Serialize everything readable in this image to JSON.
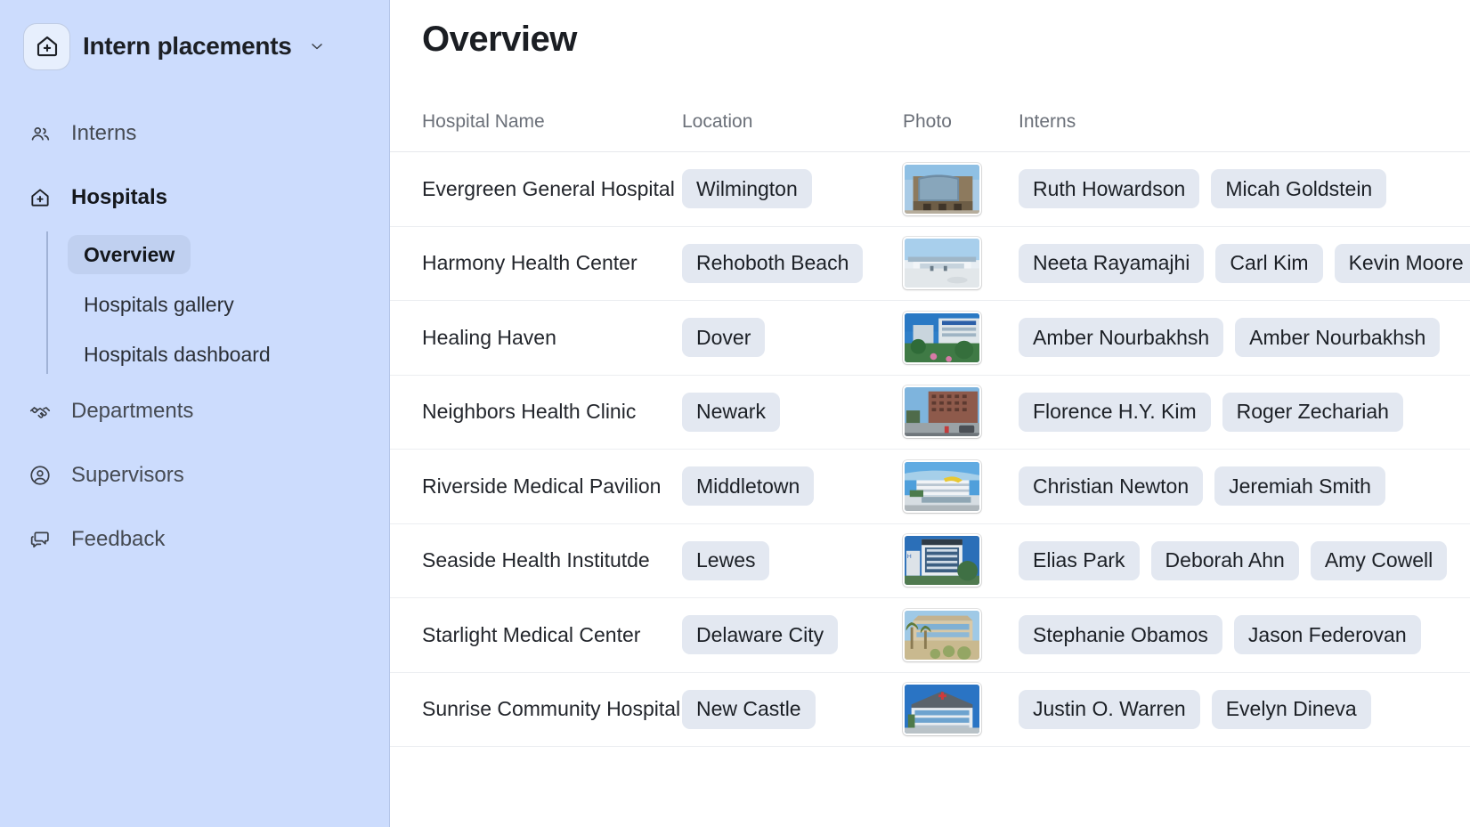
{
  "sidebar": {
    "workspace": {
      "title": "Intern placements",
      "icon": "home-plus-icon",
      "caret": "chevron-down-icon"
    },
    "items": [
      {
        "label": "Interns",
        "icon": "people-icon",
        "active": false
      },
      {
        "label": "Hospitals",
        "icon": "home-plus-icon",
        "active": true
      },
      {
        "label": "Departments",
        "icon": "handshake-icon",
        "active": false
      },
      {
        "label": "Supervisors",
        "icon": "user-circle-icon",
        "active": false
      },
      {
        "label": "Feedback",
        "icon": "chat-bubbles-icon",
        "active": false
      }
    ],
    "subitems": [
      {
        "label": "Overview",
        "active": true
      },
      {
        "label": "Hospitals gallery",
        "active": false
      },
      {
        "label": "Hospitals dashboard",
        "active": false
      }
    ]
  },
  "main": {
    "title": "Overview",
    "columns": [
      "Hospital Name",
      "Location",
      "Photo",
      "Interns"
    ],
    "rows": [
      {
        "name": "Evergreen General Hospital",
        "location": "Wilmington",
        "photo": "hospital-photo-curved-glass-facade",
        "interns": [
          "Ruth Howardson",
          "Micah Goldstein"
        ]
      },
      {
        "name": "Harmony Health Center",
        "location": "Rehoboth Beach",
        "photo": "hospital-photo-low-white-entrance",
        "interns": [
          "Neeta Rayamajhi",
          "Carl Kim",
          "Kevin Moore"
        ]
      },
      {
        "name": "Healing Haven",
        "location": "Dover",
        "photo": "hospital-photo-blue-sky-tower",
        "interns": [
          "Amber Nourbakhsh",
          "Amber Nourbakhsh"
        ]
      },
      {
        "name": "Neighbors Health Clinic",
        "location": "Newark",
        "photo": "hospital-photo-brick-highrise",
        "interns": [
          "Florence H.Y. Kim",
          "Roger Zechariah"
        ]
      },
      {
        "name": "Riverside Medical Pavilion",
        "location": "Middletown",
        "photo": "hospital-photo-modern-white-pavilion",
        "interns": [
          "Christian Newton",
          "Jeremiah Smith"
        ]
      },
      {
        "name": "Seaside Health Institutde",
        "location": "Lewes",
        "photo": "hospital-photo-dark-glass-block",
        "interns": [
          "Elias Park",
          "Deborah Ahn",
          "Amy Cowell"
        ]
      },
      {
        "name": "Starlight Medical Center",
        "location": "Delaware City",
        "photo": "hospital-photo-palm-trees-entrance",
        "interns": [
          "Stephanie Obamos",
          "Jason Federovan"
        ]
      },
      {
        "name": "Sunrise Community Hospital",
        "location": "New Castle",
        "photo": "hospital-photo-angular-glass-roof",
        "interns": [
          "Justin O. Warren",
          "Evelyn Dineva"
        ]
      }
    ]
  },
  "colors": {
    "sidebar_bg": "#ccdcfd",
    "sidebar_active_pill": "#c0d0f0",
    "chip_bg": "#e3e8f1",
    "page_bg": "#ffffff",
    "text_primary": "#1b1e23",
    "text_muted": "#6b7079"
  }
}
